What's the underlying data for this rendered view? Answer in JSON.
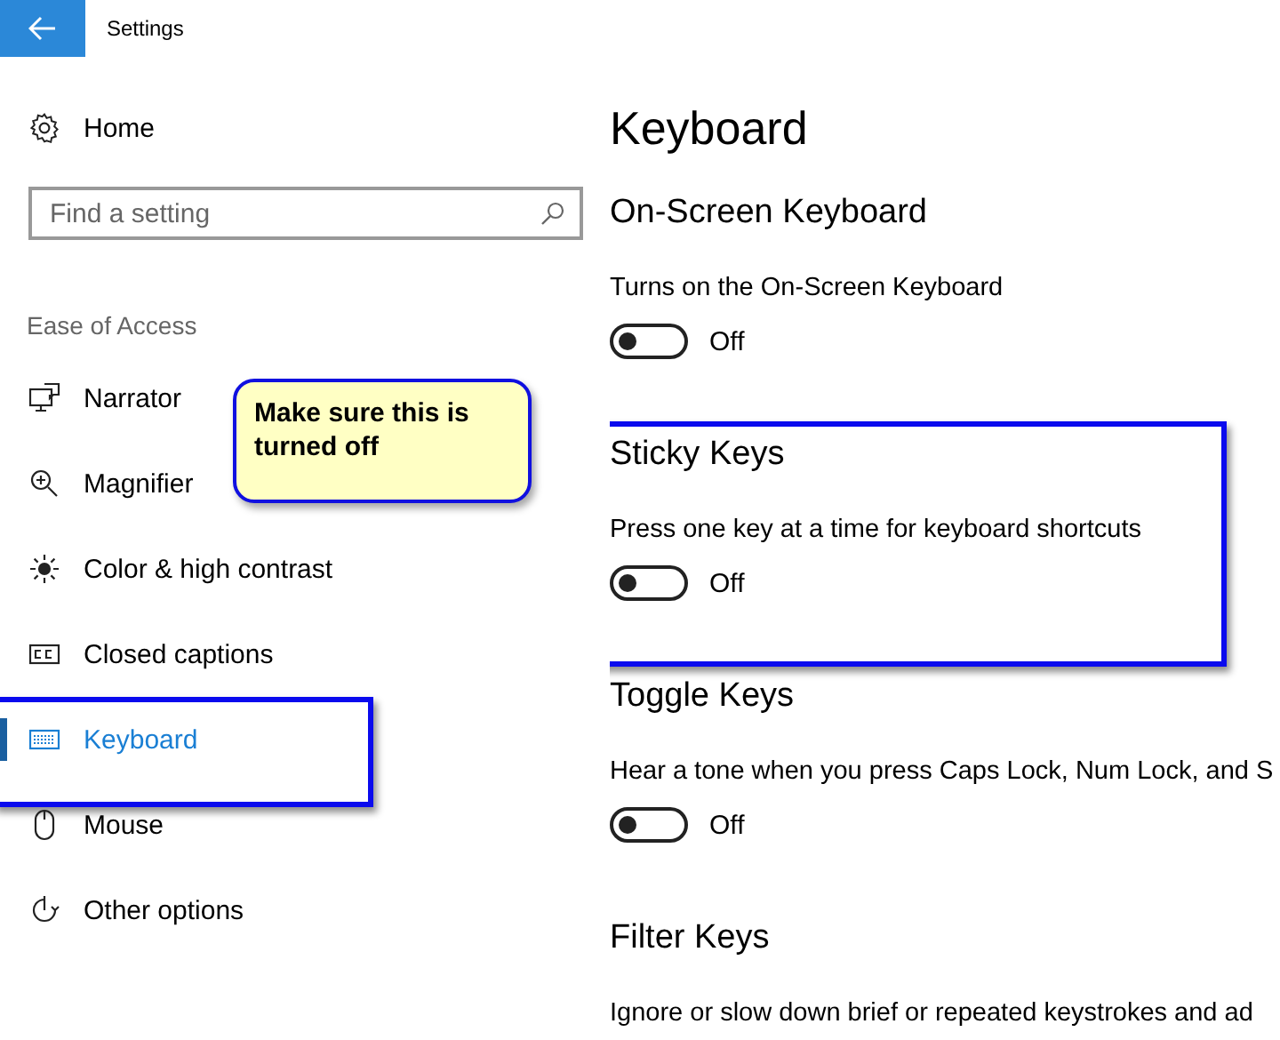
{
  "window": {
    "title": "Settings"
  },
  "sidebar": {
    "home": "Home",
    "search": {
      "placeholder": "Find a setting"
    },
    "group_label": "Ease of Access",
    "items": [
      {
        "kind": "narrator",
        "label": "Narrator",
        "selected": false,
        "highlighted": false
      },
      {
        "kind": "magnifier",
        "label": "Magnifier",
        "selected": false,
        "highlighted": false
      },
      {
        "kind": "contrast",
        "label": "Color & high contrast",
        "selected": false,
        "highlighted": false
      },
      {
        "kind": "captions",
        "label": "Closed captions",
        "selected": false,
        "highlighted": false
      },
      {
        "kind": "keyboard",
        "label": "Keyboard",
        "selected": true,
        "highlighted": true
      },
      {
        "kind": "mouse",
        "label": "Mouse",
        "selected": false,
        "highlighted": false
      },
      {
        "kind": "other",
        "label": "Other options",
        "selected": false,
        "highlighted": false
      }
    ]
  },
  "page": {
    "title": "Keyboard",
    "sections": [
      {
        "title": "On-Screen Keyboard",
        "description": "Turns on the On-Screen Keyboard",
        "toggle": {
          "on": false,
          "label": "Off"
        },
        "highlighted": false
      },
      {
        "title": "Sticky Keys",
        "description": "Press one key at a time for keyboard shortcuts",
        "toggle": {
          "on": false,
          "label": "Off"
        },
        "highlighted": true
      },
      {
        "title": "Toggle Keys",
        "description": "Hear a tone when you press Caps Lock, Num Lock, and S",
        "toggle": {
          "on": false,
          "label": "Off"
        },
        "highlighted": false
      },
      {
        "title": "Filter Keys",
        "description": "Ignore or slow down brief or repeated keystrokes and ad",
        "highlighted": false
      }
    ]
  },
  "callout": {
    "text": "Make sure this is turned off"
  }
}
